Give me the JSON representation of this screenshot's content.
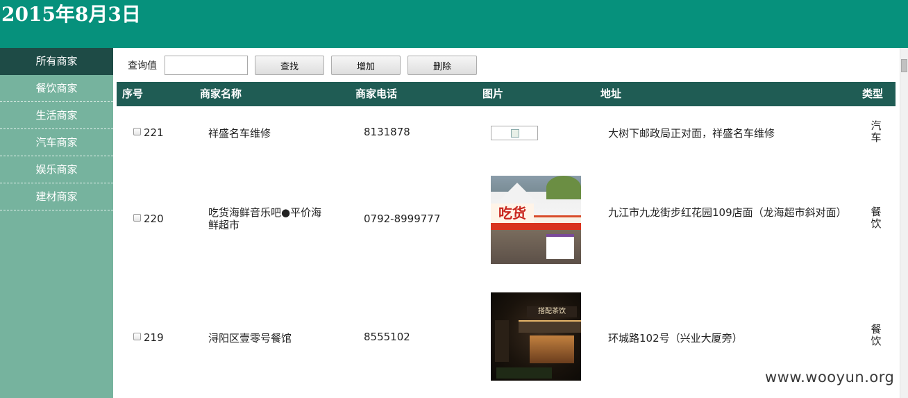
{
  "header": {
    "date": "2015年8月3日"
  },
  "sidebar": {
    "items": [
      {
        "label": "所有商家"
      },
      {
        "label": "餐饮商家"
      },
      {
        "label": "生活商家"
      },
      {
        "label": "汽车商家"
      },
      {
        "label": "娱乐商家"
      },
      {
        "label": "建材商家"
      }
    ]
  },
  "toolbar": {
    "query_label": "查询值",
    "query_value": "",
    "find_label": "查找",
    "add_label": "增加",
    "delete_label": "删除"
  },
  "table": {
    "headers": {
      "id": "序号",
      "name": "商家名称",
      "phone": "商家电话",
      "image": "图片",
      "address": "地址",
      "type": "类型"
    },
    "rows": [
      {
        "id": "221",
        "name": "祥盛名车维修",
        "phone": "8131878",
        "address": "大树下邮政局正对面，祥盛名车维修",
        "type": "汽车"
      },
      {
        "id": "220",
        "name": "吃货海鲜音乐吧●平价海鲜超市",
        "phone": "0792-8999777",
        "address": "九江市九龙街步红花园109店面（龙海超市斜对面）",
        "type": "餐饮",
        "image_sign": "吃货"
      },
      {
        "id": "219",
        "name": "浔阳区壹零号餐馆",
        "phone": "8555102",
        "address": "环城路102号（兴业大厦旁）",
        "type": "餐饮",
        "image_sign": "搭配茶饮"
      }
    ]
  },
  "watermark": "www.wooyun.org"
}
